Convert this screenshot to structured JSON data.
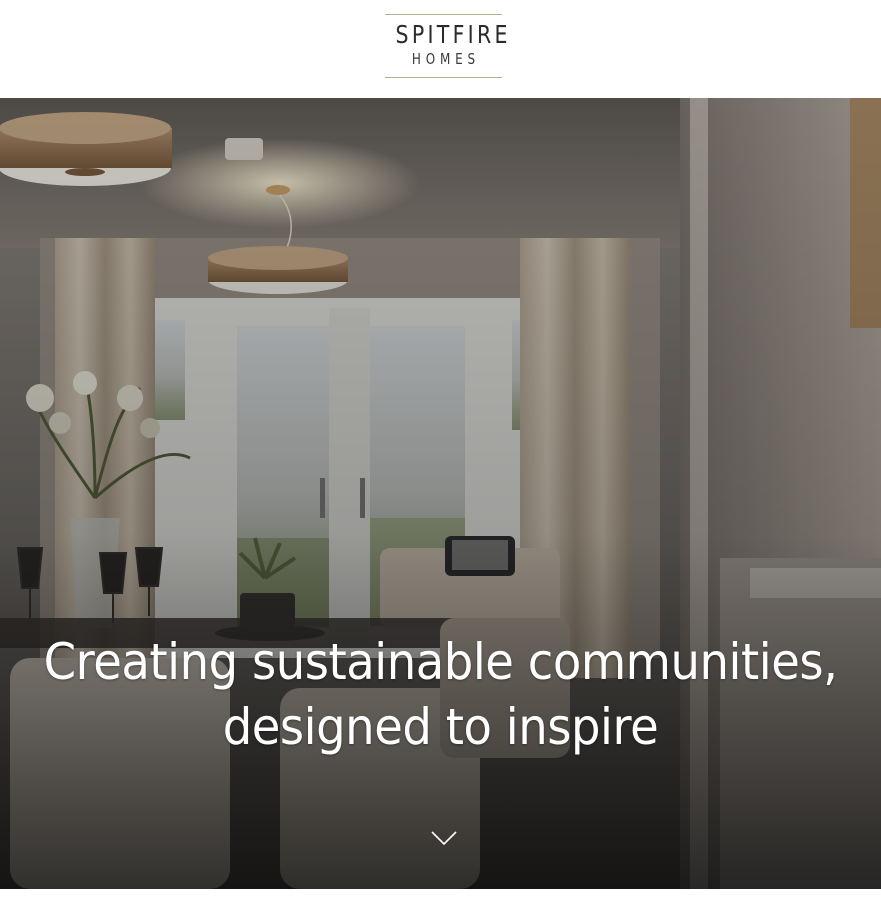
{
  "logo": {
    "main": "SPITFIRE",
    "sub": "HOMES"
  },
  "hero": {
    "headline_line1": "Creating sustainable communities,",
    "headline_line2": "designed to inspire",
    "scroll_icon": "chevron-down-icon"
  },
  "colors": {
    "logo_rule": "#b7ad8f",
    "logo_text": "#2b2b2b",
    "headline_text": "#ffffff"
  }
}
